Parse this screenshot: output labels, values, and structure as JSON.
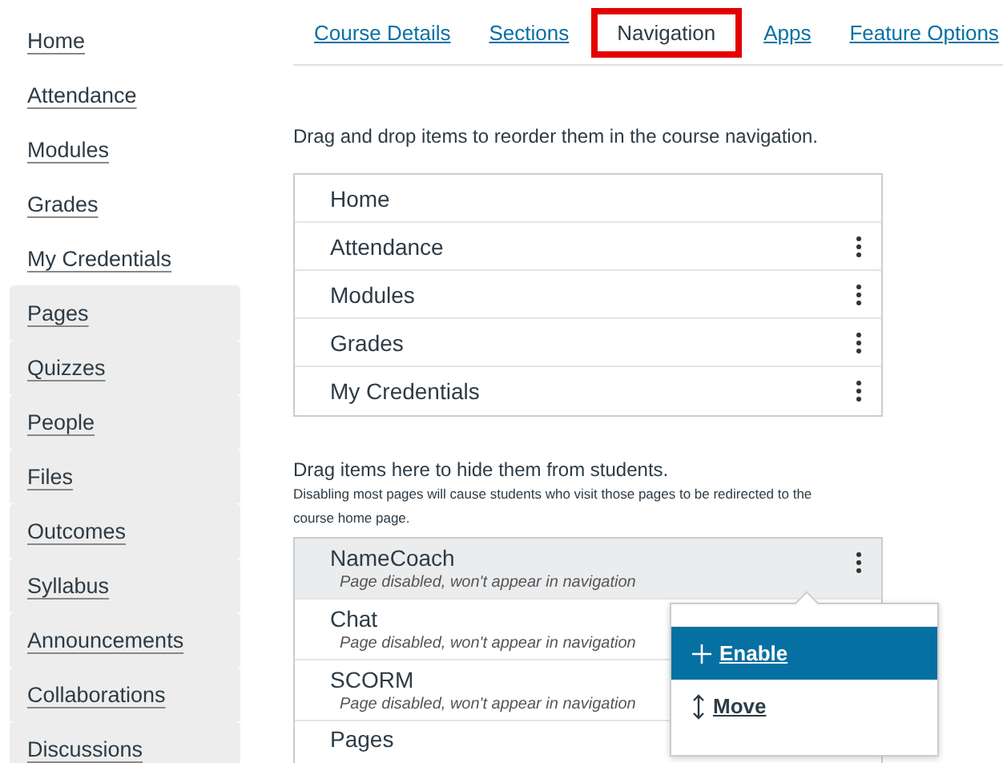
{
  "sidebar": {
    "items": [
      {
        "label": "Home",
        "hidden": false
      },
      {
        "label": "Attendance",
        "hidden": false
      },
      {
        "label": "Modules",
        "hidden": false
      },
      {
        "label": "Grades",
        "hidden": false
      },
      {
        "label": "My Credentials",
        "hidden": false
      },
      {
        "label": "Pages",
        "hidden": true
      },
      {
        "label": "Quizzes",
        "hidden": true
      },
      {
        "label": "People",
        "hidden": true
      },
      {
        "label": "Files",
        "hidden": true
      },
      {
        "label": "Outcomes",
        "hidden": true
      },
      {
        "label": "Syllabus",
        "hidden": true
      },
      {
        "label": "Announcements",
        "hidden": true
      },
      {
        "label": "Collaborations",
        "hidden": true
      },
      {
        "label": "Discussions",
        "hidden": true
      }
    ]
  },
  "tabs": [
    {
      "label": "Course Details",
      "selected": false
    },
    {
      "label": "Sections",
      "selected": false
    },
    {
      "label": "Navigation",
      "selected": true
    },
    {
      "label": "Apps",
      "selected": false
    },
    {
      "label": "Feature Options",
      "selected": false
    }
  ],
  "enabled": {
    "instructions": "Drag and drop items to reorder them in the course navigation.",
    "items": [
      {
        "label": "Home",
        "menu": false
      },
      {
        "label": "Attendance",
        "menu": true
      },
      {
        "label": "Modules",
        "menu": true
      },
      {
        "label": "Grades",
        "menu": true
      },
      {
        "label": "My Credentials",
        "menu": true
      }
    ]
  },
  "disabled": {
    "instructions": "Drag items here to hide them from students.",
    "note": "Disabling most pages will cause students who visit those pages to be redirected to the course home page.",
    "items": [
      {
        "label": "NameCoach",
        "status": "Page disabled, won't appear in navigation",
        "selected": true
      },
      {
        "label": "Chat",
        "status": "Page disabled, won't appear in navigation",
        "selected": false
      },
      {
        "label": "SCORM",
        "status": "Page disabled, won't appear in navigation",
        "selected": false
      },
      {
        "label": "Pages",
        "selected": false
      }
    ]
  },
  "menu": {
    "items": [
      {
        "label": "Enable",
        "kind": "enable",
        "selected": true
      },
      {
        "label": "Move",
        "kind": "move",
        "selected": false
      }
    ]
  }
}
